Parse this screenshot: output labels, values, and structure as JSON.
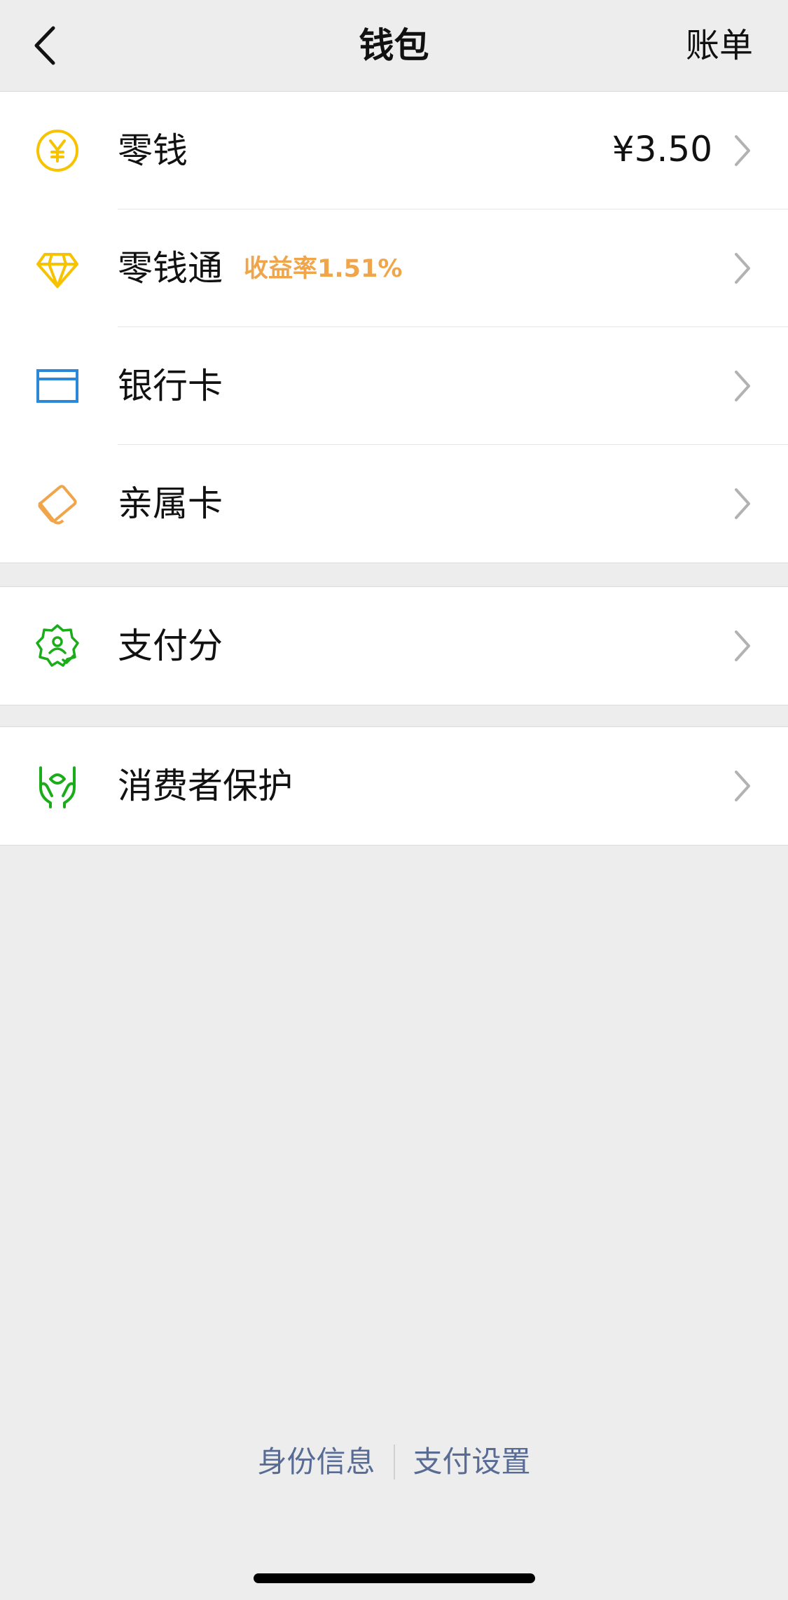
{
  "nav": {
    "title": "钱包",
    "right_label": "账单"
  },
  "items_group1": [
    {
      "label": "零钱",
      "value": "¥3.50",
      "icon": "yuan-coin-icon",
      "color": "#f7c300"
    },
    {
      "label": "零钱通",
      "badge": "收益率1.51%",
      "icon": "diamond-icon",
      "color": "#f7c300"
    },
    {
      "label": "银行卡",
      "icon": "bank-card-icon",
      "color": "#2b88d8"
    },
    {
      "label": "亲属卡",
      "icon": "family-card-icon",
      "color": "#f0a54a"
    }
  ],
  "items_group2": [
    {
      "label": "支付分",
      "icon": "pay-score-icon",
      "color": "#1aad19"
    }
  ],
  "items_group3": [
    {
      "label": "消费者保护",
      "icon": "hands-protect-icon",
      "color": "#1aad19"
    }
  ],
  "footer": {
    "identity": "身份信息",
    "settings": "支付设置"
  },
  "colors": {
    "link": "#576b95",
    "badge": "#f0a54a",
    "background": "#ededed"
  }
}
